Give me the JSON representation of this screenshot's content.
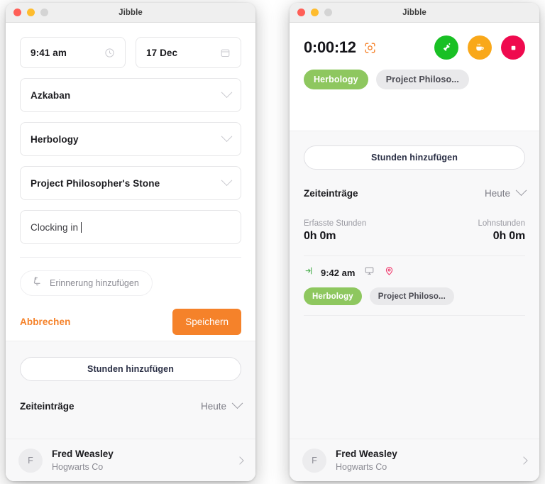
{
  "window_left": {
    "title": "Jibble",
    "traffic_lights": [
      "close-button",
      "minimize-button",
      "zoom-button"
    ],
    "form": {
      "time_value": "9:41 am",
      "time_icon": "clock-icon",
      "date_value": "17 Dec",
      "date_icon": "calendar-icon",
      "activity_value": "Azkaban",
      "subactivity_value": "Herbology",
      "project_value": "Project Philosopher's Stone",
      "note_value": "Clocking in",
      "chevron_icon": "chevron-down-icon"
    },
    "reminder": {
      "label": "Erinnerung hinzufügen",
      "icon": "bell-reminder-icon"
    },
    "actions": {
      "cancel_label": "Abbrechen",
      "save_label": "Speichern"
    },
    "panel": {
      "add_hours_label": "Stunden hinzufügen",
      "entries_title": "Zeiteinträge",
      "entries_filter": "Heute",
      "entries_filter_icon": "chevron-down-icon"
    },
    "user": {
      "initial": "F",
      "name": "Fred Weasley",
      "org": "Hogwarts Co",
      "chevron_icon": "chevron-right-icon"
    }
  },
  "window_right": {
    "title": "Jibble",
    "traffic_lights": [
      "close-button",
      "minimize-button",
      "zoom-button"
    ],
    "timer": {
      "value": "0:00:12",
      "face_icon": "face-scan-icon"
    },
    "controls": [
      {
        "name": "switch-activity-button",
        "icon": "switch-icon",
        "color": "#19c024"
      },
      {
        "name": "take-break-button",
        "icon": "coffee-icon",
        "color": "#f9a81a"
      },
      {
        "name": "clock-out-button",
        "icon": "stop-icon",
        "color": "#ef0a4e"
      }
    ],
    "chips": [
      {
        "label": "Herbology",
        "style": "green"
      },
      {
        "label": "Project Philoso...",
        "style": "grey"
      }
    ],
    "panel": {
      "add_hours_label": "Stunden hinzufügen",
      "entries_title": "Zeiteinträge",
      "entries_filter": "Heute",
      "entries_filter_icon": "chevron-down-icon"
    },
    "stats": {
      "tracked_caption": "Erfasste Stunden",
      "tracked_value": "0h 0m",
      "payable_caption": "Lohnstunden",
      "payable_value": "0h 0m"
    },
    "entry": {
      "in_icon": "clock-in-arrow-icon",
      "time": "9:42 am",
      "device_icon": "desktop-icon",
      "location_icon": "location-pin-icon",
      "chips": [
        {
          "label": "Herbology",
          "style": "green"
        },
        {
          "label": "Project Philoso...",
          "style": "grey"
        }
      ]
    },
    "user": {
      "initial": "F",
      "name": "Fred Weasley",
      "org": "Hogwarts Co",
      "chevron_icon": "chevron-right-icon"
    }
  },
  "colors": {
    "accent_orange": "#f5822a",
    "chip_green": "#8ec75f",
    "btn_green": "#19c024",
    "btn_amber": "#f9a81a",
    "btn_pink": "#ef0a4e",
    "pin_pink": "#f0386b"
  }
}
